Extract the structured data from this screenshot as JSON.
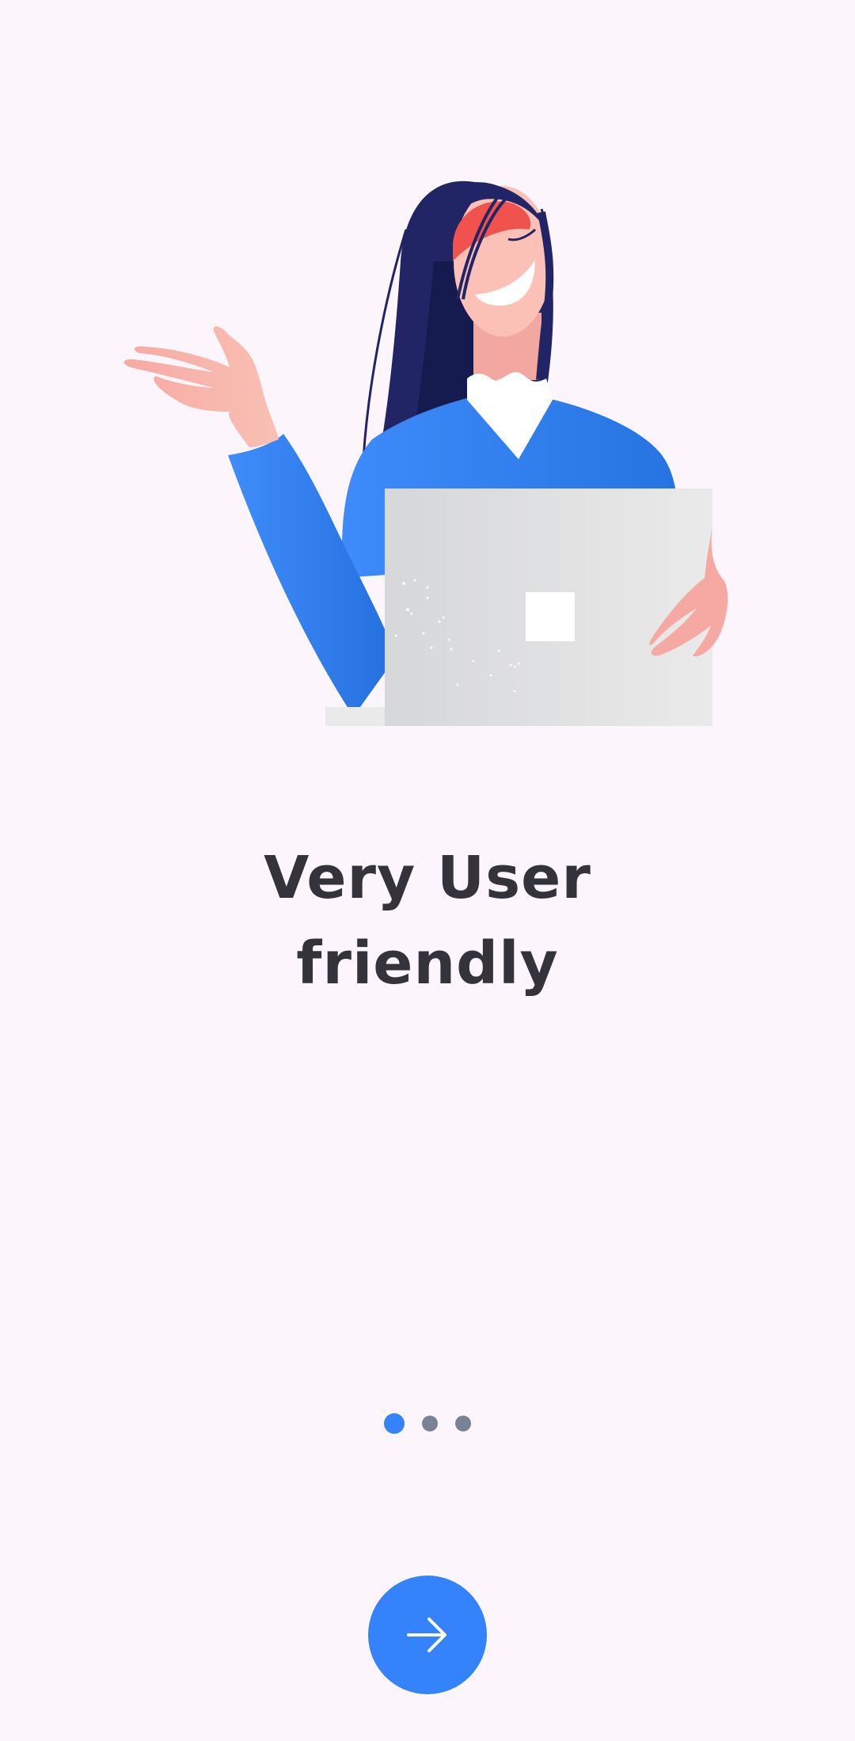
{
  "illustration": {
    "subject": "woman-with-laptop-waving"
  },
  "onboarding": {
    "title_line1": "Very User",
    "title_line2": "friendly"
  },
  "pager": {
    "total": 3,
    "current": 1
  },
  "next_button": {
    "icon": "arrow-right-icon"
  },
  "colors": {
    "background": "#fcf5fc",
    "accent": "#3483fa",
    "title": "#34333b",
    "dot_inactive": "#7a8296"
  }
}
